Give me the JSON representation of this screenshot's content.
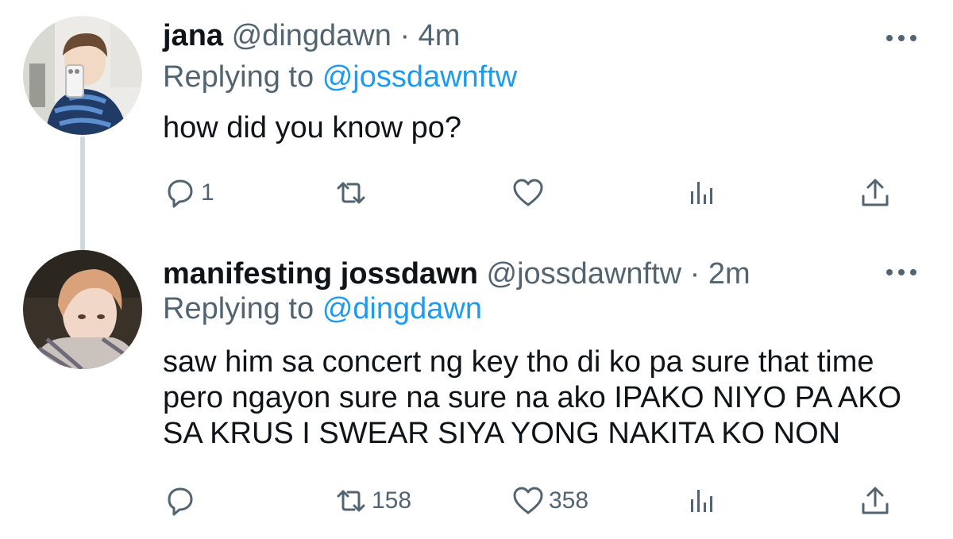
{
  "thread": {
    "tweets": [
      {
        "display_name": "jana",
        "handle": "@dingdawn",
        "separator": "·",
        "time": "4m",
        "replying_prefix": "Replying to",
        "replying_to": "@jossdawnftw",
        "text_lines": [
          "how did you know po?"
        ],
        "replies": "1",
        "retweets": "",
        "likes": ""
      },
      {
        "display_name": "manifesting jossdawn",
        "handle": "@jossdawnftw",
        "separator": "·",
        "time": "2m",
        "replying_prefix": "Replying to",
        "replying_to": "@dingdawn",
        "text_lines": [
          "saw him sa concert ng key tho di ko pa sure that time",
          "pero ngayon sure na sure na ako IPAKO NIYO PA AKO",
          "SA KRUS I SWEAR SIYA YONG NAKITA KO NON"
        ],
        "replies": "",
        "retweets": "158",
        "likes": "358"
      }
    ]
  },
  "icons": {
    "more": "more-horizontal-icon",
    "reply": "reply-icon",
    "retweet": "retweet-icon",
    "like": "heart-icon",
    "stats": "analytics-icon",
    "share": "share-icon"
  },
  "colors": {
    "text": "#0f1419",
    "secondary": "#536471",
    "link": "#1d9bf0",
    "thread_line": "#cfd9de"
  }
}
